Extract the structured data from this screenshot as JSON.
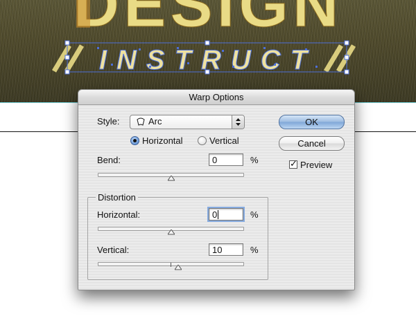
{
  "artwork": {
    "headline_text": "DESIGN",
    "warp_text": "INSTRUCT"
  },
  "dialog": {
    "title": "Warp Options",
    "style_label": "Style:",
    "style_value": "Arc",
    "orientation": {
      "horizontal_label": "Horizontal",
      "vertical_label": "Vertical",
      "selected": "horizontal"
    },
    "bend": {
      "label": "Bend:",
      "value": "0",
      "unit": "%"
    },
    "distortion": {
      "group_label": "Distortion",
      "horizontal": {
        "label": "Horizontal:",
        "value": "0",
        "unit": "%"
      },
      "vertical": {
        "label": "Vertical:",
        "value": "10",
        "unit": "%"
      }
    },
    "buttons": {
      "ok": "OK",
      "cancel": "Cancel"
    },
    "preview": {
      "label": "Preview",
      "checked": true
    }
  },
  "colors": {
    "art_letter": "#e9db86",
    "selection_blue": "#4d6fd8",
    "default_button": "#9bbbe0"
  }
}
